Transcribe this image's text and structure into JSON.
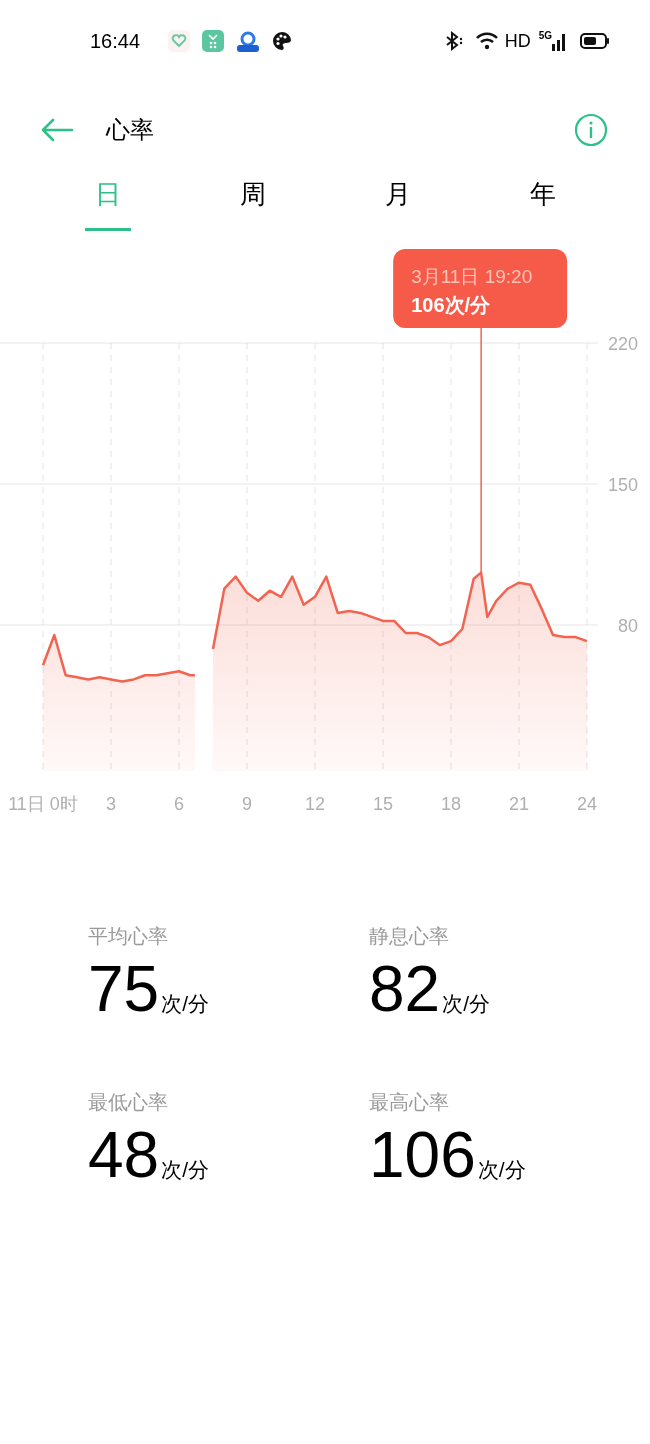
{
  "status_bar": {
    "time": "16:44",
    "network_label": "HD",
    "signal_label": "5G"
  },
  "header": {
    "title": "心率"
  },
  "tabs": [
    {
      "label": "日",
      "selected": true
    },
    {
      "label": "周",
      "selected": false
    },
    {
      "label": "月",
      "selected": false
    },
    {
      "label": "年",
      "selected": false
    }
  ],
  "chart": {
    "chart_data": {
      "type": "area",
      "x": [
        0,
        0.5,
        1,
        1.5,
        2,
        2.5,
        3,
        3.5,
        4,
        4.5,
        5,
        5.5,
        6,
        6.5,
        7,
        7.5,
        8,
        8.5,
        9,
        9.5,
        10,
        10.5,
        11,
        11.5,
        12,
        12.5,
        13,
        13.5,
        14,
        14.5,
        15,
        15.5,
        16,
        16.5,
        17,
        17.5,
        18,
        18.5,
        19,
        19.33,
        19.6,
        20,
        20.5,
        21,
        21.5,
        22,
        22.5,
        23,
        23.5,
        24
      ],
      "series": [
        {
          "color": "#f26450",
          "values": [
            60,
            75,
            55,
            54,
            53,
            54,
            53,
            52,
            53,
            55,
            55,
            56,
            57,
            55,
            null,
            68,
            98,
            104,
            96,
            92,
            97,
            94,
            104,
            90,
            94,
            104,
            86,
            87,
            86,
            84,
            82,
            82,
            76,
            76,
            74,
            70,
            72,
            78,
            103,
            106,
            84,
            92,
            98,
            101,
            100,
            88,
            75,
            74,
            74,
            72
          ]
        }
      ],
      "xlim": [
        0,
        24
      ],
      "ylim": [
        7.5,
        220
      ],
      "xticks": [
        {
          "value": 0,
          "label": "11日 0时"
        },
        3,
        6,
        9,
        12,
        15,
        18,
        21,
        24
      ],
      "yticks": [
        80,
        150,
        220
      ],
      "grid": true,
      "annotations": [
        "3月11日 19:20",
        "106次/分"
      ]
    }
  },
  "stats": [
    {
      "label": "平均心率",
      "value": "75",
      "unit": "次/分"
    },
    {
      "label": "静息心率",
      "value": "82",
      "unit": "次/分"
    },
    {
      "label": "最低心率",
      "value": "48",
      "unit": "次/分"
    },
    {
      "label": "最高心率",
      "value": "106",
      "unit": "次/分"
    }
  ]
}
